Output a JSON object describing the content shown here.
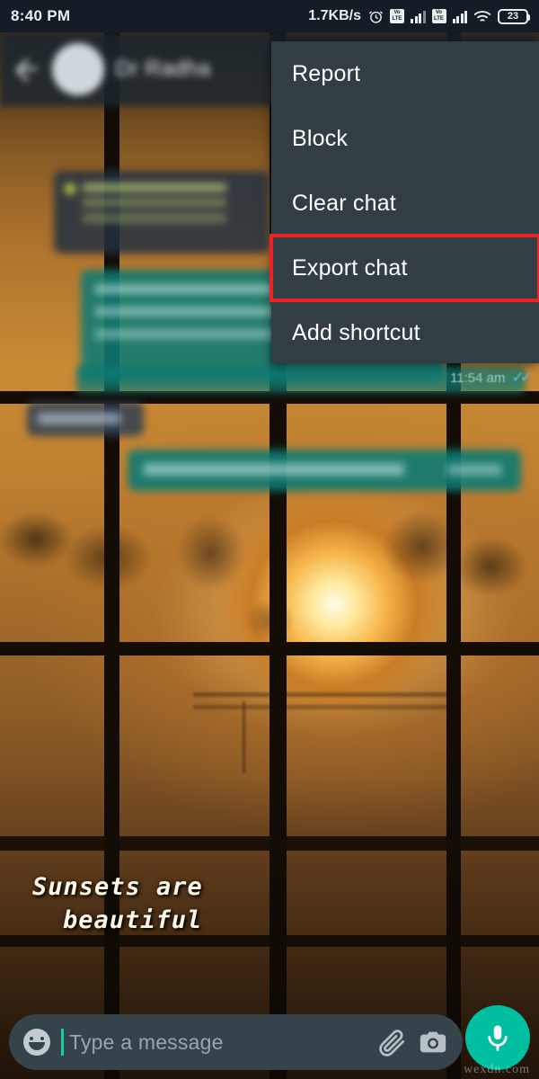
{
  "status_bar": {
    "time": "8:40 PM",
    "network_speed": "1.7KB/s",
    "alarm_icon": "alarm-clock-icon",
    "sim1_label": "VoLTE",
    "sim2_label": "VoLTE",
    "wifi_icon": "wifi-icon",
    "battery_percent": "23"
  },
  "app_bar": {
    "back_icon": "back-arrow-icon",
    "avatar": "contact-avatar",
    "contact_name": "Dr Radha"
  },
  "menu": {
    "items": [
      {
        "label": "Report",
        "highlighted": false
      },
      {
        "label": "Block",
        "highlighted": false
      },
      {
        "label": "Clear chat",
        "highlighted": false
      },
      {
        "label": "Export chat",
        "highlighted": true
      },
      {
        "label": "Add shortcut",
        "highlighted": false
      }
    ],
    "highlight_color": "#ef2026",
    "background_color": "#333e44"
  },
  "conversation": {
    "last_message_time": "11:54 am",
    "read_receipt": "✓✓"
  },
  "wallpaper": {
    "caption_line_1": "Sunsets are",
    "caption_line_2": "beautiful"
  },
  "input_bar": {
    "emoji_icon": "emoji-smiley-icon",
    "placeholder": "Type a message",
    "value": "",
    "attach_icon": "paperclip-icon",
    "camera_icon": "camera-icon",
    "mic_icon": "microphone-icon",
    "mic_color": "#00bfa0",
    "caret_color": "#13cfa6"
  },
  "watermark": {
    "text": "wexdn.com"
  }
}
